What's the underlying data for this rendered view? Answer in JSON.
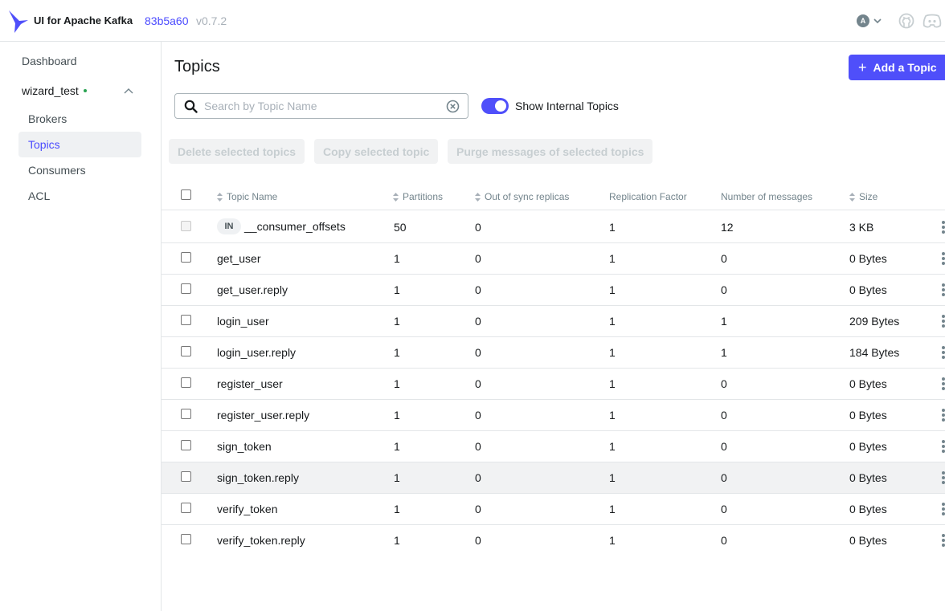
{
  "header": {
    "brand": "UI for Apache Kafka",
    "version_hash": "83b5a60",
    "version": "v0.7.2",
    "user_initial": "A"
  },
  "sidebar": {
    "dashboard": "Dashboard",
    "cluster": "wizard_test",
    "items": [
      {
        "label": "Brokers",
        "active": false
      },
      {
        "label": "Topics",
        "active": true
      },
      {
        "label": "Consumers",
        "active": false
      },
      {
        "label": "ACL",
        "active": false
      }
    ]
  },
  "main": {
    "title": "Topics",
    "add_button": "Add a Topic",
    "search_placeholder": "Search by Topic Name",
    "search_value": "",
    "toggle_label": "Show Internal Topics",
    "toggle_on": true,
    "actions": [
      "Delete selected topics",
      "Copy selected topic",
      "Purge messages of selected topics"
    ]
  },
  "table": {
    "columns": [
      "Topic Name",
      "Partitions",
      "Out of sync replicas",
      "Replication Factor",
      "Number of messages",
      "Size"
    ],
    "internal_badge": "IN",
    "rows": [
      {
        "name": "__consumer_offsets",
        "partitions": "50",
        "out_of_sync": "0",
        "replication": "1",
        "messages": "12",
        "size": "3 KB",
        "internal": true
      },
      {
        "name": "get_user",
        "partitions": "1",
        "out_of_sync": "0",
        "replication": "1",
        "messages": "0",
        "size": "0 Bytes",
        "internal": false
      },
      {
        "name": "get_user.reply",
        "partitions": "1",
        "out_of_sync": "0",
        "replication": "1",
        "messages": "0",
        "size": "0 Bytes",
        "internal": false
      },
      {
        "name": "login_user",
        "partitions": "1",
        "out_of_sync": "0",
        "replication": "1",
        "messages": "1",
        "size": "209 Bytes",
        "internal": false
      },
      {
        "name": "login_user.reply",
        "partitions": "1",
        "out_of_sync": "0",
        "replication": "1",
        "messages": "1",
        "size": "184 Bytes",
        "internal": false
      },
      {
        "name": "register_user",
        "partitions": "1",
        "out_of_sync": "0",
        "replication": "1",
        "messages": "0",
        "size": "0 Bytes",
        "internal": false
      },
      {
        "name": "register_user.reply",
        "partitions": "1",
        "out_of_sync": "0",
        "replication": "1",
        "messages": "0",
        "size": "0 Bytes",
        "internal": false
      },
      {
        "name": "sign_token",
        "partitions": "1",
        "out_of_sync": "0",
        "replication": "1",
        "messages": "0",
        "size": "0 Bytes",
        "internal": false
      },
      {
        "name": "sign_token.reply",
        "partitions": "1",
        "out_of_sync": "0",
        "replication": "1",
        "messages": "0",
        "size": "0 Bytes",
        "internal": false
      },
      {
        "name": "verify_token",
        "partitions": "1",
        "out_of_sync": "0",
        "replication": "1",
        "messages": "0",
        "size": "0 Bytes",
        "internal": false
      },
      {
        "name": "verify_token.reply",
        "partitions": "1",
        "out_of_sync": "0",
        "replication": "1",
        "messages": "0",
        "size": "0 Bytes",
        "internal": false
      }
    ]
  },
  "colors": {
    "accent": "#4f4ffa",
    "link": "#4c4cff",
    "online": "#29a352"
  }
}
